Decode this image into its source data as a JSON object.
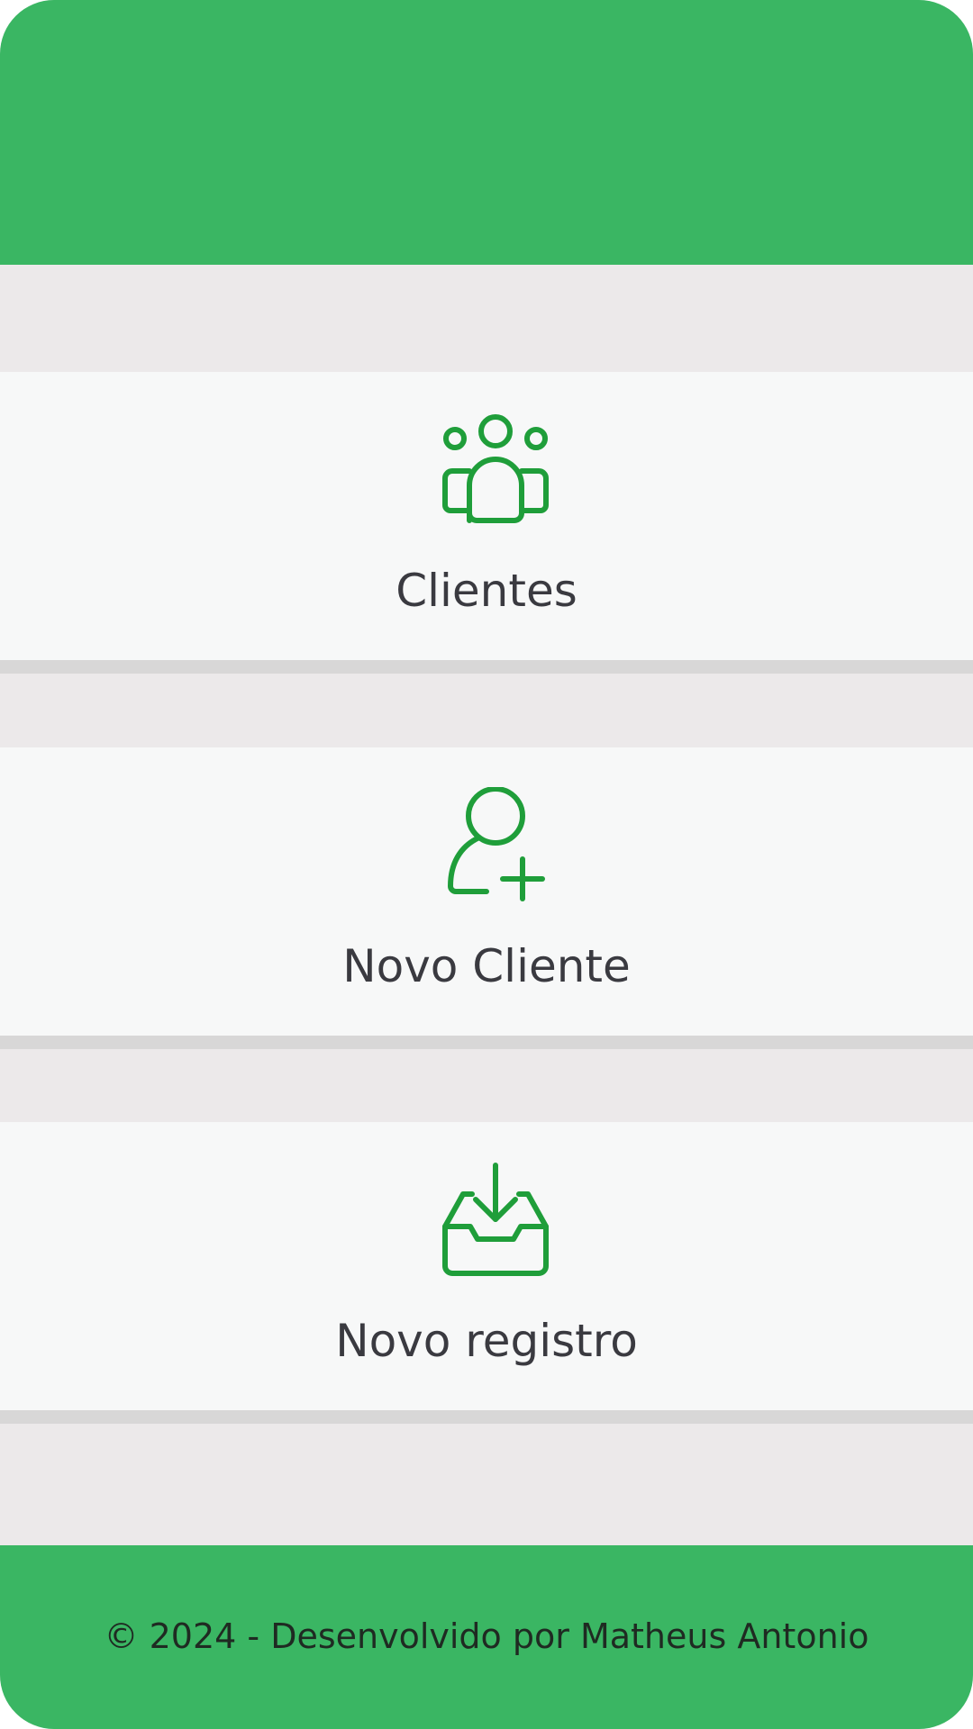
{
  "colors": {
    "brand_green": "#3ab663",
    "icon_green": "#1f9e3a",
    "page_background": "#ece9ea",
    "card_background": "#f7f8f8",
    "card_divider": "#d8d7d7",
    "label_text": "#3a3a40"
  },
  "menu": {
    "items": [
      {
        "label": "Clientes",
        "icon": "users-group-icon"
      },
      {
        "label": "Novo Cliente",
        "icon": "user-plus-icon"
      },
      {
        "label": "Novo registro",
        "icon": "inbox-download-icon"
      }
    ]
  },
  "footer": {
    "text": "© 2024 - Desenvolvido por Matheus Antonio"
  }
}
